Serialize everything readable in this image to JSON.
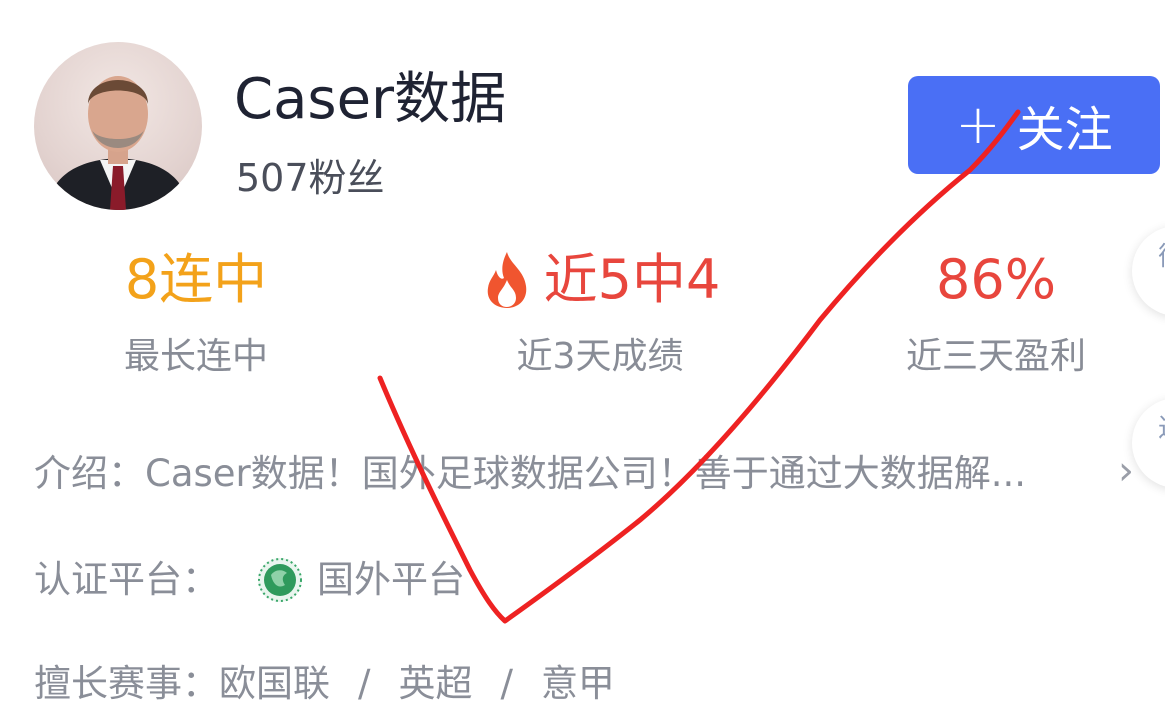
{
  "profile": {
    "name": "Caser数据",
    "fans": "507粉丝",
    "follow_label": "关注",
    "follow_icon": "plus-icon"
  },
  "stats": [
    {
      "value": "8连中",
      "label": "最长连中"
    },
    {
      "value": "近5中4",
      "label": "近3天成绩",
      "icon": "fire-icon"
    },
    {
      "value": "86%",
      "label": "近三天盈利"
    }
  ],
  "intro": {
    "prefix": "介绍：",
    "text": "Caser数据！国外足球数据公司！善于通过大数据解..."
  },
  "platform": {
    "prefix": "认证平台：",
    "name": "国外平台",
    "icon": "platform-logo-icon"
  },
  "specialty": {
    "prefix": "擅长赛事：",
    "items": [
      "欧国联",
      "英超",
      "意甲"
    ],
    "separator": "/"
  },
  "side_tabs": [
    "循",
    "过"
  ],
  "colors": {
    "accent": "#4a6ff5",
    "streak": "#f3a21a",
    "highlight": "#e8463d",
    "muted": "#888c96",
    "annotation": "#ee2222"
  }
}
